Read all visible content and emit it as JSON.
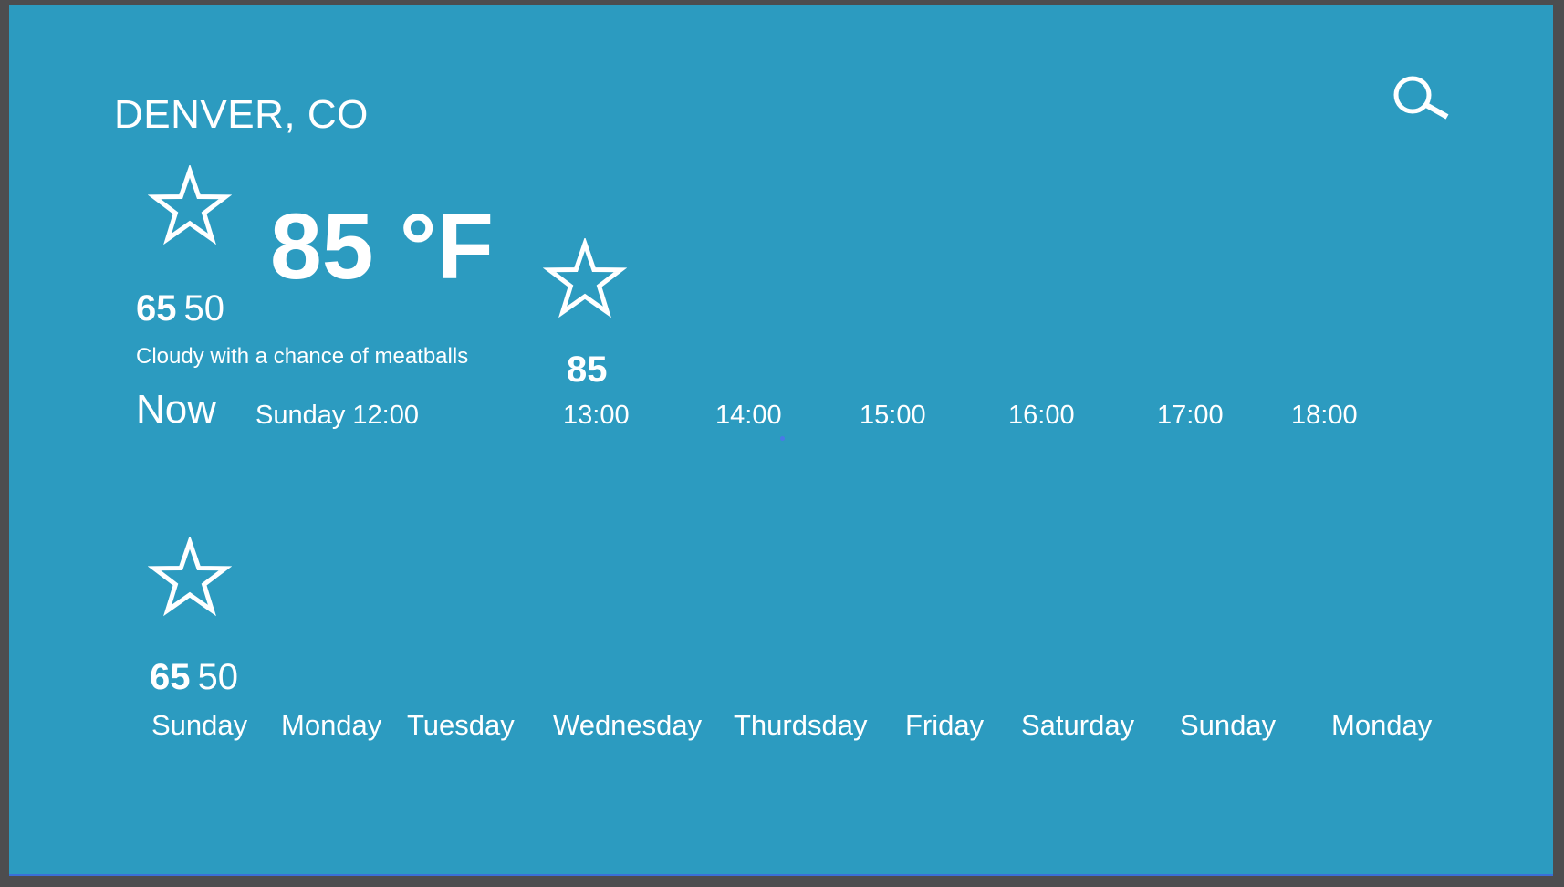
{
  "location": {
    "city": "DENVER, CO"
  },
  "search": {
    "icon": "search-icon"
  },
  "current": {
    "icon": "star-icon",
    "temperature": "85 °F",
    "high": "65",
    "low": "50",
    "description": "Cloudy with a chance of meatballs",
    "now_label": "Now",
    "datetime": "Sunday 12:00"
  },
  "hourly": {
    "times": [
      "13:00",
      "14:00",
      "15:00",
      "16:00",
      "17:00",
      "18:00"
    ],
    "selected": {
      "icon": "star-icon",
      "temperature": "85"
    }
  },
  "daily": {
    "days": [
      "Sunday",
      "Monday",
      "Tuesday",
      "Wednesday",
      "Thurdsday",
      "Friday",
      "Saturday",
      "Sunday",
      "Monday"
    ],
    "selected": {
      "icon": "star-icon",
      "high": "65",
      "low": "50"
    }
  },
  "colors": {
    "background": "#2c9bc0",
    "foreground": "#ffffff",
    "frame": "#4d4d4f"
  }
}
